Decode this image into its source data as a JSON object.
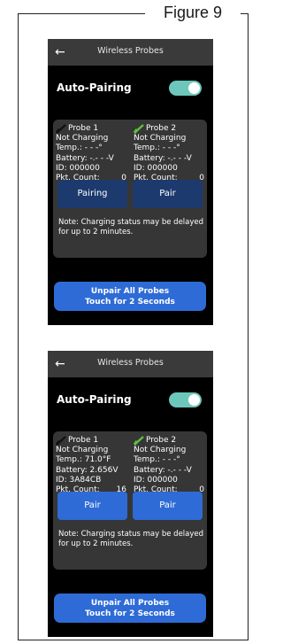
{
  "figure": {
    "title": "Figure 9"
  },
  "screens": [
    {
      "header_title": "Wireless Probes",
      "auto_pairing_label": "Auto-Pairing",
      "auto_pairing_on": true,
      "probes": [
        {
          "name": "Probe 1",
          "icon_color": "#111111",
          "charging": "Not Charging",
          "temp": "Temp.: - - -°",
          "battery": "Battery: -.- - -V",
          "id": "ID: 000000",
          "pkt_label": "Pkt. Count:",
          "pkt_value": "0",
          "button_label": "Pairing"
        },
        {
          "name": "Probe 2",
          "icon_color": "#5fbf3f",
          "charging": "Not Charging",
          "temp": "Temp.: - - -°",
          "battery": "Battery: -.- - -V",
          "id": "ID: 000000",
          "pkt_label": "Pkt. Count:",
          "pkt_value": "0",
          "button_label": "Pair"
        }
      ],
      "note": "Note: Charging status may be delayed for up to 2 minutes.",
      "unpair_line1": "Unpair  All  Probes",
      "unpair_line2": "Touch for 2 Seconds"
    },
    {
      "header_title": "Wireless Probes",
      "auto_pairing_label": "Auto-Pairing",
      "auto_pairing_on": true,
      "probes": [
        {
          "name": "Probe 1",
          "icon_color": "#111111",
          "charging": "Not Charging",
          "temp": "Temp.: 71.0°F",
          "battery": "Battery: 2.656V",
          "id": "ID: 3A84CB",
          "pkt_label": "Pkt. Count:",
          "pkt_value": "16",
          "button_label": "Pair"
        },
        {
          "name": "Probe 2",
          "icon_color": "#5fbf3f",
          "charging": "Not Charging",
          "temp": "Temp.: - - -°",
          "battery": "Battery: -.- - -V",
          "id": "ID: 000000",
          "pkt_label": "Pkt. Count:",
          "pkt_value": "0",
          "button_label": "Pair"
        }
      ],
      "note": "Note: Charging status may be delayed for up to 2 minutes.",
      "unpair_line1": "Unpair  All  Probes",
      "unpair_line2": "Touch for 2 Seconds"
    }
  ],
  "icons": {
    "back": "arrow-left-icon",
    "probe": "probe-icon"
  },
  "colors": {
    "header_bg": "#3a3a3a",
    "panel_bg": "#363636",
    "toggle": "#6cc7ba",
    "pairing_button": "#1d3a6e",
    "pair_button": "#2e6bd6",
    "unpair_button": "#2e6bd6"
  }
}
